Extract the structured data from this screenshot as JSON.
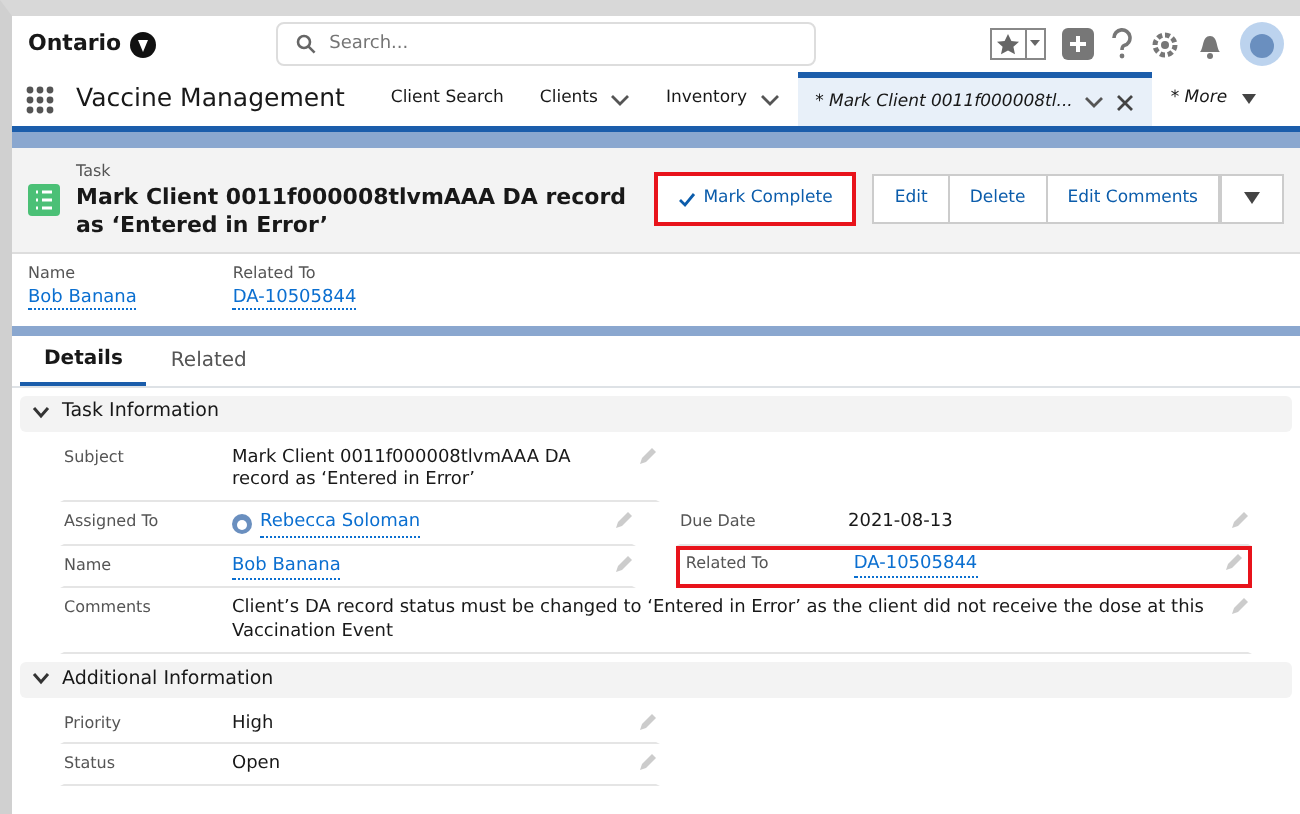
{
  "header": {
    "logo": "Ontario",
    "search_placeholder": "Search..."
  },
  "nav": {
    "app_name": "Vaccine Management",
    "items": [
      {
        "label": "Client Search",
        "kind": "link",
        "selected": false
      },
      {
        "label": "Clients",
        "kind": "menu",
        "selected": false
      },
      {
        "label": "Inventory",
        "kind": "menu",
        "selected": false
      },
      {
        "label": "* Mark Client 0011f000008tl...",
        "kind": "record",
        "selected": true
      },
      {
        "label": "* More",
        "kind": "more",
        "selected": false
      }
    ]
  },
  "record": {
    "type": "Task",
    "title": "Mark Client 0011f000008tlvmAAA DA record as ‘Entered in Error’",
    "actions": [
      {
        "label": "Mark Complete",
        "kind": "check",
        "highlighted": true
      },
      {
        "label": "Edit",
        "kind": "plain",
        "highlighted": false
      },
      {
        "label": "Delete",
        "kind": "plain",
        "highlighted": false
      },
      {
        "label": "Edit Comments",
        "kind": "plain",
        "highlighted": false
      }
    ],
    "highlights": [
      {
        "label": "Name",
        "value": "Bob Banana"
      },
      {
        "label": "Related To",
        "value": "DA-10505844"
      }
    ]
  },
  "tabs": [
    {
      "label": "Details",
      "selected": true
    },
    {
      "label": "Related",
      "selected": false
    }
  ],
  "sections": [
    {
      "title": "Task Information",
      "expanded": true,
      "rows": [
        {
          "fields": [
            {
              "label": "Subject",
              "value": "Mark Client 0011f000008tlvmAAA DA record as ‘Entered in Error’",
              "kind": "text",
              "highlighted": false
            }
          ]
        },
        {
          "fields": [
            {
              "label": "Assigned To",
              "value": "Rebecca Soloman",
              "kind": "user",
              "highlighted": false
            },
            {
              "label": "Due Date",
              "value": "2021-08-13",
              "kind": "text",
              "highlighted": false
            }
          ]
        },
        {
          "fields": [
            {
              "label": "Name",
              "value": "Bob Banana",
              "kind": "link",
              "highlighted": false
            },
            {
              "label": "Related To",
              "value": "DA-10505844",
              "kind": "link",
              "highlighted": true
            }
          ]
        },
        {
          "fields": [
            {
              "label": "Comments",
              "value": "Client’s DA record status must be changed to ‘Entered in Error’ as the client did not receive the dose at this Vaccination Event",
              "kind": "long_text",
              "highlighted": false
            }
          ]
        }
      ]
    },
    {
      "title": "Additional Information",
      "expanded": true,
      "rows": [
        {
          "fields": [
            {
              "label": "Priority",
              "value": "High",
              "kind": "text",
              "highlighted": false
            }
          ]
        },
        {
          "fields": [
            {
              "label": "Status",
              "value": "Open",
              "kind": "text",
              "highlighted": false
            }
          ]
        }
      ]
    }
  ]
}
